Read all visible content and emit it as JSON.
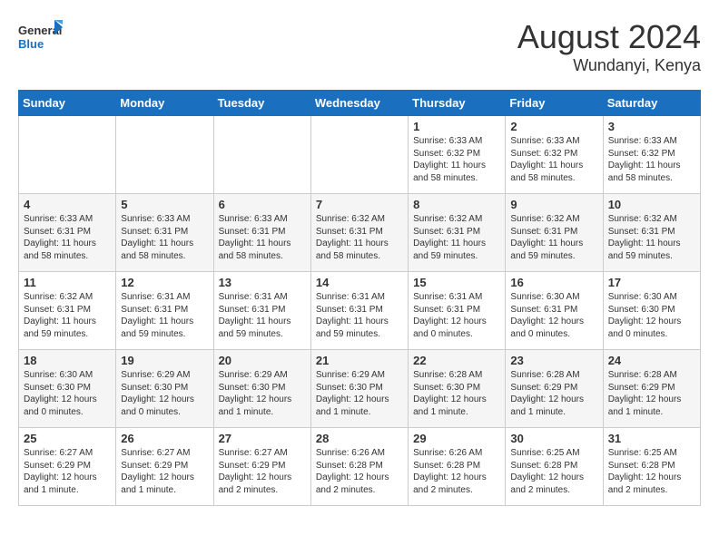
{
  "header": {
    "logo_general": "General",
    "logo_blue": "Blue",
    "month_year": "August 2024",
    "location": "Wundanyi, Kenya"
  },
  "weekdays": [
    "Sunday",
    "Monday",
    "Tuesday",
    "Wednesday",
    "Thursday",
    "Friday",
    "Saturday"
  ],
  "weeks": [
    [
      {
        "day": "",
        "info": ""
      },
      {
        "day": "",
        "info": ""
      },
      {
        "day": "",
        "info": ""
      },
      {
        "day": "",
        "info": ""
      },
      {
        "day": "1",
        "info": "Sunrise: 6:33 AM\nSunset: 6:32 PM\nDaylight: 11 hours\nand 58 minutes."
      },
      {
        "day": "2",
        "info": "Sunrise: 6:33 AM\nSunset: 6:32 PM\nDaylight: 11 hours\nand 58 minutes."
      },
      {
        "day": "3",
        "info": "Sunrise: 6:33 AM\nSunset: 6:32 PM\nDaylight: 11 hours\nand 58 minutes."
      }
    ],
    [
      {
        "day": "4",
        "info": "Sunrise: 6:33 AM\nSunset: 6:31 PM\nDaylight: 11 hours\nand 58 minutes."
      },
      {
        "day": "5",
        "info": "Sunrise: 6:33 AM\nSunset: 6:31 PM\nDaylight: 11 hours\nand 58 minutes."
      },
      {
        "day": "6",
        "info": "Sunrise: 6:33 AM\nSunset: 6:31 PM\nDaylight: 11 hours\nand 58 minutes."
      },
      {
        "day": "7",
        "info": "Sunrise: 6:32 AM\nSunset: 6:31 PM\nDaylight: 11 hours\nand 58 minutes."
      },
      {
        "day": "8",
        "info": "Sunrise: 6:32 AM\nSunset: 6:31 PM\nDaylight: 11 hours\nand 59 minutes."
      },
      {
        "day": "9",
        "info": "Sunrise: 6:32 AM\nSunset: 6:31 PM\nDaylight: 11 hours\nand 59 minutes."
      },
      {
        "day": "10",
        "info": "Sunrise: 6:32 AM\nSunset: 6:31 PM\nDaylight: 11 hours\nand 59 minutes."
      }
    ],
    [
      {
        "day": "11",
        "info": "Sunrise: 6:32 AM\nSunset: 6:31 PM\nDaylight: 11 hours\nand 59 minutes."
      },
      {
        "day": "12",
        "info": "Sunrise: 6:31 AM\nSunset: 6:31 PM\nDaylight: 11 hours\nand 59 minutes."
      },
      {
        "day": "13",
        "info": "Sunrise: 6:31 AM\nSunset: 6:31 PM\nDaylight: 11 hours\nand 59 minutes."
      },
      {
        "day": "14",
        "info": "Sunrise: 6:31 AM\nSunset: 6:31 PM\nDaylight: 11 hours\nand 59 minutes."
      },
      {
        "day": "15",
        "info": "Sunrise: 6:31 AM\nSunset: 6:31 PM\nDaylight: 12 hours\nand 0 minutes."
      },
      {
        "day": "16",
        "info": "Sunrise: 6:30 AM\nSunset: 6:31 PM\nDaylight: 12 hours\nand 0 minutes."
      },
      {
        "day": "17",
        "info": "Sunrise: 6:30 AM\nSunset: 6:30 PM\nDaylight: 12 hours\nand 0 minutes."
      }
    ],
    [
      {
        "day": "18",
        "info": "Sunrise: 6:30 AM\nSunset: 6:30 PM\nDaylight: 12 hours\nand 0 minutes."
      },
      {
        "day": "19",
        "info": "Sunrise: 6:29 AM\nSunset: 6:30 PM\nDaylight: 12 hours\nand 0 minutes."
      },
      {
        "day": "20",
        "info": "Sunrise: 6:29 AM\nSunset: 6:30 PM\nDaylight: 12 hours\nand 1 minute."
      },
      {
        "day": "21",
        "info": "Sunrise: 6:29 AM\nSunset: 6:30 PM\nDaylight: 12 hours\nand 1 minute."
      },
      {
        "day": "22",
        "info": "Sunrise: 6:28 AM\nSunset: 6:30 PM\nDaylight: 12 hours\nand 1 minute."
      },
      {
        "day": "23",
        "info": "Sunrise: 6:28 AM\nSunset: 6:29 PM\nDaylight: 12 hours\nand 1 minute."
      },
      {
        "day": "24",
        "info": "Sunrise: 6:28 AM\nSunset: 6:29 PM\nDaylight: 12 hours\nand 1 minute."
      }
    ],
    [
      {
        "day": "25",
        "info": "Sunrise: 6:27 AM\nSunset: 6:29 PM\nDaylight: 12 hours\nand 1 minute."
      },
      {
        "day": "26",
        "info": "Sunrise: 6:27 AM\nSunset: 6:29 PM\nDaylight: 12 hours\nand 1 minute."
      },
      {
        "day": "27",
        "info": "Sunrise: 6:27 AM\nSunset: 6:29 PM\nDaylight: 12 hours\nand 2 minutes."
      },
      {
        "day": "28",
        "info": "Sunrise: 6:26 AM\nSunset: 6:28 PM\nDaylight: 12 hours\nand 2 minutes."
      },
      {
        "day": "29",
        "info": "Sunrise: 6:26 AM\nSunset: 6:28 PM\nDaylight: 12 hours\nand 2 minutes."
      },
      {
        "day": "30",
        "info": "Sunrise: 6:25 AM\nSunset: 6:28 PM\nDaylight: 12 hours\nand 2 minutes."
      },
      {
        "day": "31",
        "info": "Sunrise: 6:25 AM\nSunset: 6:28 PM\nDaylight: 12 hours\nand 2 minutes."
      }
    ]
  ]
}
